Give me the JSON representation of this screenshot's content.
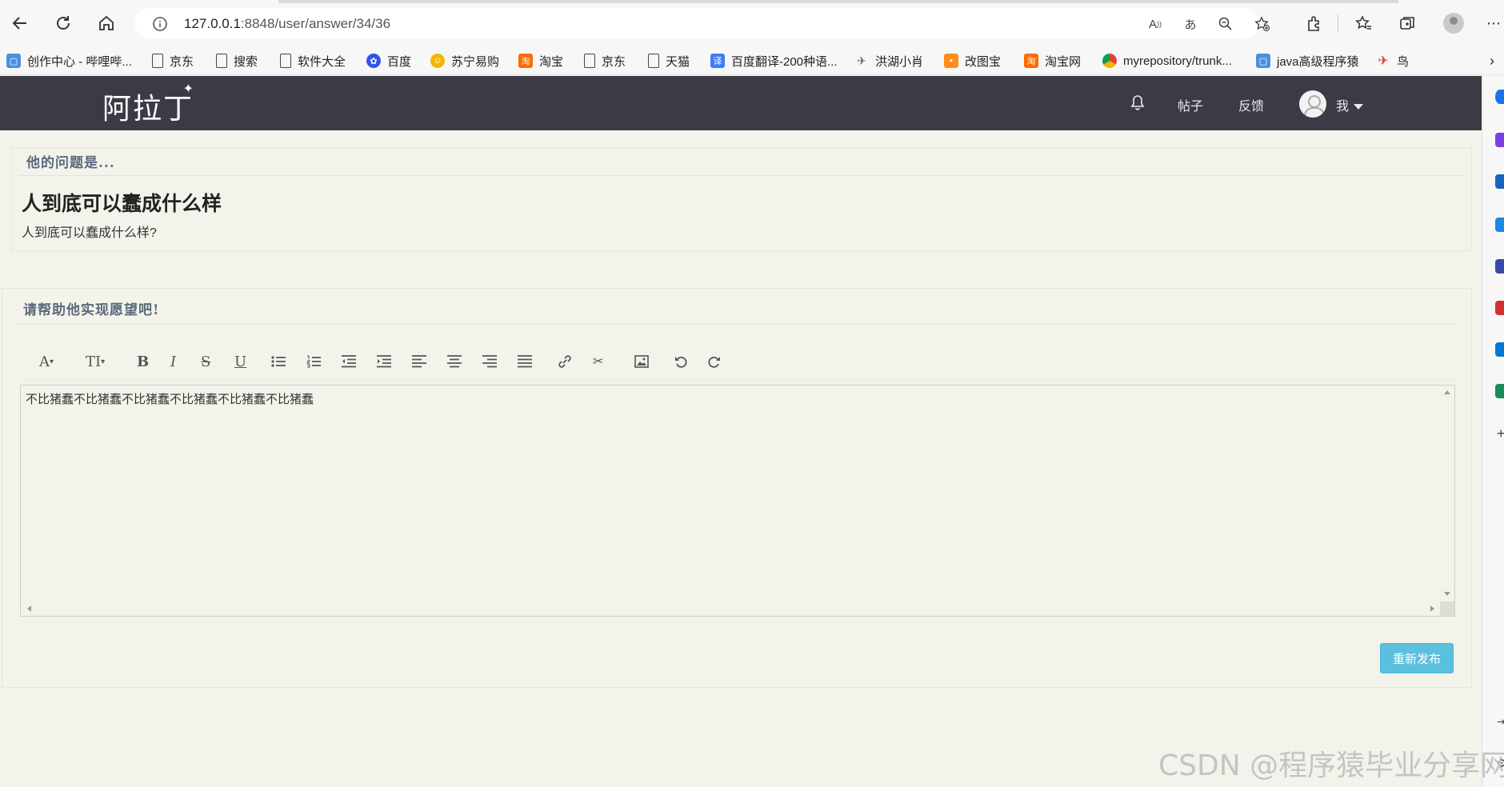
{
  "browser": {
    "url_host": "127.0.0.1",
    "url_path": ":8848/user/answer/34/36",
    "bookmarks": [
      {
        "label": "创作中心 - 哔哩哔...",
        "icon": "bilibili-icon",
        "color": "#4a90e2"
      },
      {
        "label": "京东",
        "icon": "page-icon"
      },
      {
        "label": "搜索",
        "icon": "page-icon"
      },
      {
        "label": "软件大全",
        "icon": "page-icon"
      },
      {
        "label": "百度",
        "icon": "baidu-icon",
        "color": "#2f54eb"
      },
      {
        "label": "苏宁易购",
        "icon": "suning-icon",
        "color": "#f6b400"
      },
      {
        "label": "淘宝",
        "icon": "taobao-icon",
        "color": "#ff6a00"
      },
      {
        "label": "京东",
        "icon": "page-icon"
      },
      {
        "label": "天猫",
        "icon": "page-icon"
      },
      {
        "label": "百度翻译-200种语...",
        "icon": "translate-icon",
        "color": "#3e7bfa"
      },
      {
        "label": "洪湖小肖",
        "icon": "bird-icon"
      },
      {
        "label": "改图宝",
        "icon": "gaitubao-icon",
        "color": "#ff8c1a"
      },
      {
        "label": "淘宝网",
        "icon": "taobao-icon",
        "color": "#ff6a00"
      },
      {
        "label": "myrepository/trunk...",
        "icon": "chrome-icon",
        "color": "#db4437"
      },
      {
        "label": "java高级程序猿",
        "icon": "bilibili-icon",
        "color": "#4a90e2"
      },
      {
        "label": "鸟",
        "icon": "bird-red-icon",
        "color": "#e53935"
      }
    ]
  },
  "site": {
    "logo": "阿拉丁",
    "nav_posts": "帖子",
    "nav_feedback": "反馈",
    "nav_me": "我"
  },
  "question": {
    "heading": "他的问题是...",
    "title": "人到底可以蠢成什么样",
    "body": "人到底可以蠢成什么样?"
  },
  "answer": {
    "heading": "请帮助他实现愿望吧!",
    "editor_text": "不比猪蠢不比猪蠢不比猪蠢不比猪蠢不比猪蠢不比猪蠢",
    "submit_label": "重新发布",
    "toolbar": [
      {
        "name": "font-family-icon",
        "glyph": "A▾"
      },
      {
        "name": "font-size-icon",
        "glyph": "TI▾"
      },
      {
        "name": "bold-icon",
        "glyph": "B"
      },
      {
        "name": "italic-icon",
        "glyph": "I"
      },
      {
        "name": "strikethrough-icon",
        "glyph": "S"
      },
      {
        "name": "underline-icon",
        "glyph": "U"
      },
      {
        "name": "bullet-list-icon",
        "glyph": "☰"
      },
      {
        "name": "numbered-list-icon",
        "glyph": "☷"
      },
      {
        "name": "outdent-icon",
        "glyph": "⇤"
      },
      {
        "name": "indent-icon",
        "glyph": "⇥"
      },
      {
        "name": "align-left-icon",
        "glyph": "≡"
      },
      {
        "name": "align-center-icon",
        "glyph": "≡"
      },
      {
        "name": "align-right-icon",
        "glyph": "≡"
      },
      {
        "name": "justify-icon",
        "glyph": "≣"
      },
      {
        "name": "link-icon",
        "glyph": "🔗"
      },
      {
        "name": "unlink-icon",
        "glyph": "✂"
      },
      {
        "name": "image-icon",
        "glyph": "▣"
      },
      {
        "name": "undo-icon",
        "glyph": "↶"
      },
      {
        "name": "redo-icon",
        "glyph": "↷"
      }
    ]
  },
  "watermark": "CSDN @程序猿毕业分享网"
}
